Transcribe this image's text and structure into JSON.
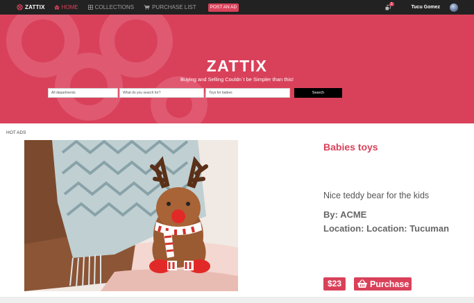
{
  "navbar": {
    "brand": "ZATTIX",
    "items": [
      {
        "label": "HOME",
        "icon": "home-icon",
        "active": true
      },
      {
        "label": "COLLECTIONS",
        "icon": "grid-icon",
        "active": false
      },
      {
        "label": "PURCHASE LIST",
        "icon": "cart-icon",
        "active": false
      }
    ],
    "post_ad": "POST AN AD",
    "notifications_count": "3",
    "username": "Tucu Gomez"
  },
  "hero": {
    "title": "ZATTIX",
    "tagline": "Buying and Selling Couldn´t be Simpler than this!",
    "search": {
      "department_value": "All departments",
      "query_placeholder": "What do you search for?",
      "location_value": "Toys for babies",
      "button_label": "Search"
    }
  },
  "section_label": "HOT ADS",
  "ad": {
    "title": "Babies toys",
    "description": "Nice teddy bear for the kids",
    "by": "By: ACME",
    "location": "Location: Location: Tucuman",
    "price": "$23",
    "purchase_label": "Purchase"
  },
  "colors": {
    "accent": "#d9415a",
    "navbar": "#222222",
    "search_button": "#000000"
  }
}
